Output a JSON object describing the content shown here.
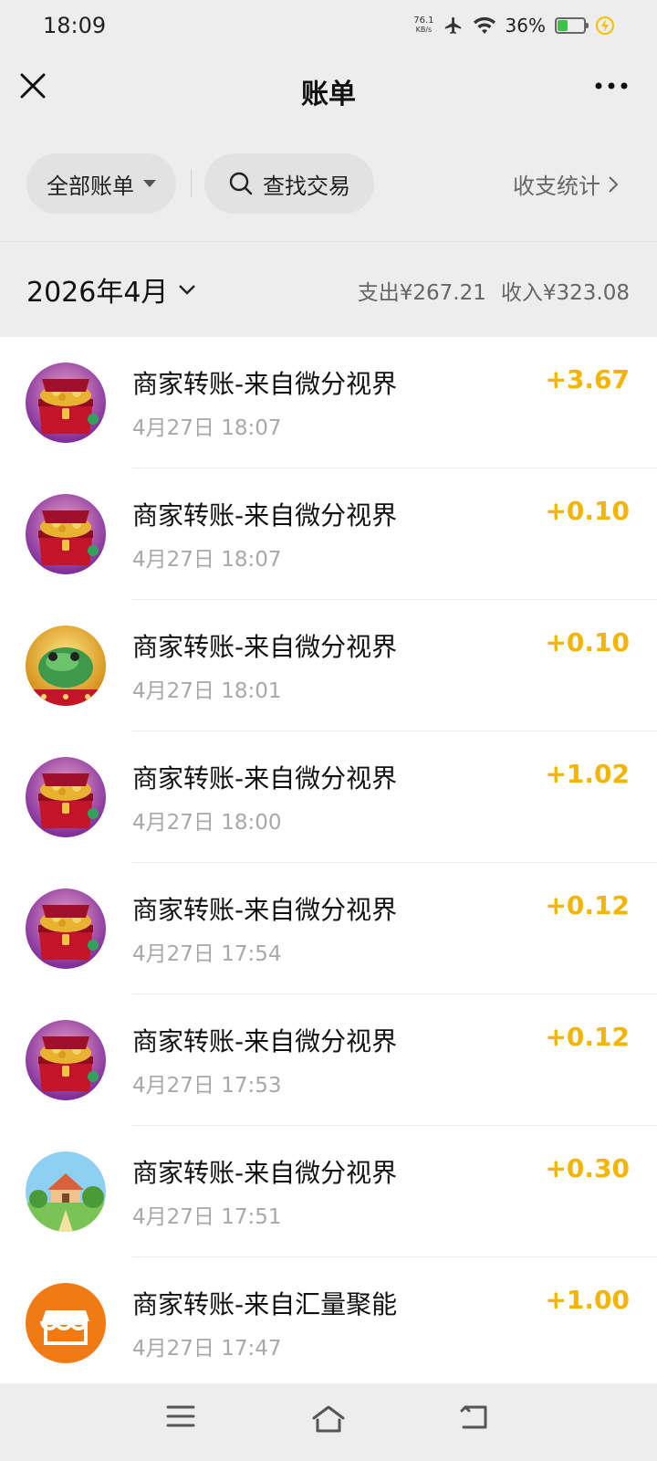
{
  "status_bar": {
    "time": "18:09",
    "net_speed_value": "76.1",
    "net_speed_unit": "KB/s",
    "battery_percent": "36%",
    "battery_level": 0.36,
    "icons": [
      "airplane-icon",
      "wifi-icon",
      "battery-icon",
      "charging-icon"
    ]
  },
  "nav": {
    "title": "账单",
    "close_icon": "close-icon",
    "more_icon": "more-icon"
  },
  "filters": {
    "all_bills": "全部账单",
    "search": "查找交易",
    "stats": "收支统计"
  },
  "month": {
    "label": "2026年4月",
    "expense": "支出¥267.21",
    "income": "收入¥323.08"
  },
  "transactions": [
    {
      "title": "商家转账-来自微分视界",
      "time": "4月27日 18:07",
      "amount": "+3.67",
      "avatar": "treasure-chest"
    },
    {
      "title": "商家转账-来自微分视界",
      "time": "4月27日 18:07",
      "amount": "+0.10",
      "avatar": "treasure-chest"
    },
    {
      "title": "商家转账-来自微分视界",
      "time": "4月27日 18:01",
      "amount": "+0.10",
      "avatar": "jade-toad"
    },
    {
      "title": "商家转账-来自微分视界",
      "time": "4月27日 18:00",
      "amount": "+1.02",
      "avatar": "treasure-chest"
    },
    {
      "title": "商家转账-来自微分视界",
      "time": "4月27日 17:54",
      "amount": "+0.12",
      "avatar": "treasure-chest"
    },
    {
      "title": "商家转账-来自微分视界",
      "time": "4月27日 17:53",
      "amount": "+0.12",
      "avatar": "treasure-chest"
    },
    {
      "title": "商家转账-来自微分视界",
      "time": "4月27日 17:51",
      "amount": "+0.30",
      "avatar": "cartoon-village"
    },
    {
      "title": "商家转账-来自汇量聚能",
      "time": "4月27日 17:47",
      "amount": "+1.00",
      "avatar": "store"
    }
  ],
  "colors": {
    "amount": "#f4b400",
    "background": "#ededed",
    "store_avatar": "#f07a14"
  },
  "bottom_nav": [
    "menu-icon",
    "home-icon",
    "back-icon"
  ]
}
